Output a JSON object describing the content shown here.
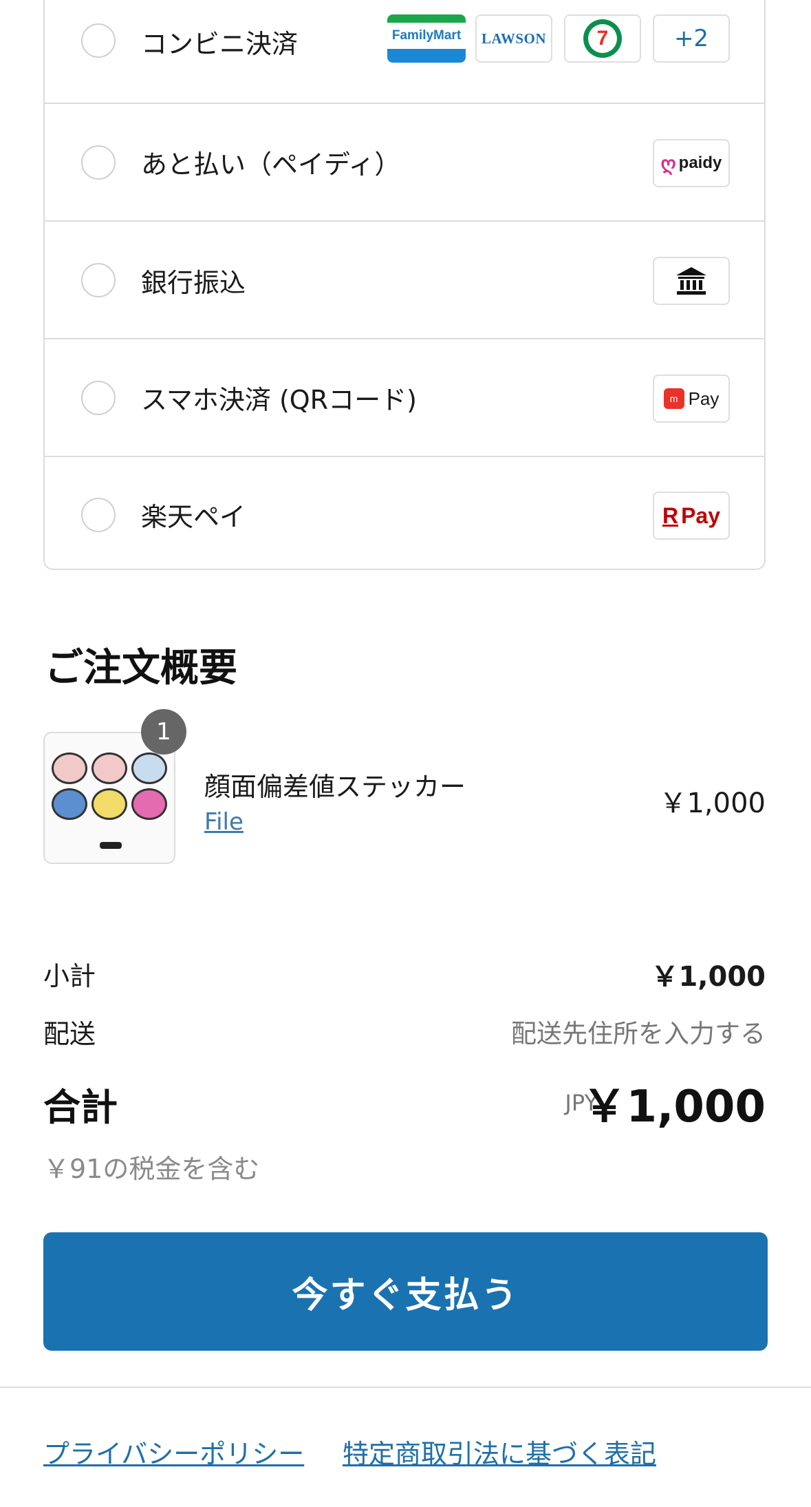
{
  "payment_methods": [
    {
      "label": "コンビニ決済",
      "logos": [
        "FamilyMart",
        "LAWSON",
        "7",
        "+2"
      ]
    },
    {
      "label": "あと払い（ペイディ）",
      "logos": [
        "paidy"
      ]
    },
    {
      "label": "銀行振込",
      "logos": [
        "bank-icon"
      ]
    },
    {
      "label": "スマホ決済 (QRコード)",
      "logos": [
        "Pay"
      ]
    },
    {
      "label": "楽天ペイ",
      "logos": [
        "Pay"
      ]
    }
  ],
  "logos": {
    "familymart": "FamilyMart",
    "lawson": "LAWSON",
    "seven": "7",
    "more": "+2",
    "paidy": "paidy",
    "merpay_mark": "m",
    "merpay": "Pay",
    "rpay_r": "R",
    "rpay": "Pay"
  },
  "summary": {
    "title": "ご注文概要",
    "item": {
      "quantity": "1",
      "name": "顔面偏差値ステッカー",
      "variant": "File",
      "price": "￥1,000"
    },
    "subtotal_label": "小計",
    "subtotal_value": "￥1,000",
    "shipping_label": "配送",
    "shipping_value": "配送先住所を入力する",
    "total_label": "合計",
    "total_currency": "JPY",
    "total_value": "￥1,000",
    "tax_note": "￥91の税金を含む"
  },
  "pay_button": "今すぐ支払う",
  "footer": {
    "privacy": "プライバシーポリシー",
    "tokushoho": "特定商取引法に基づく表記"
  },
  "colors": {
    "accent": "#1a72b0",
    "link": "#1f6fa8",
    "border": "#dcdcdc"
  }
}
